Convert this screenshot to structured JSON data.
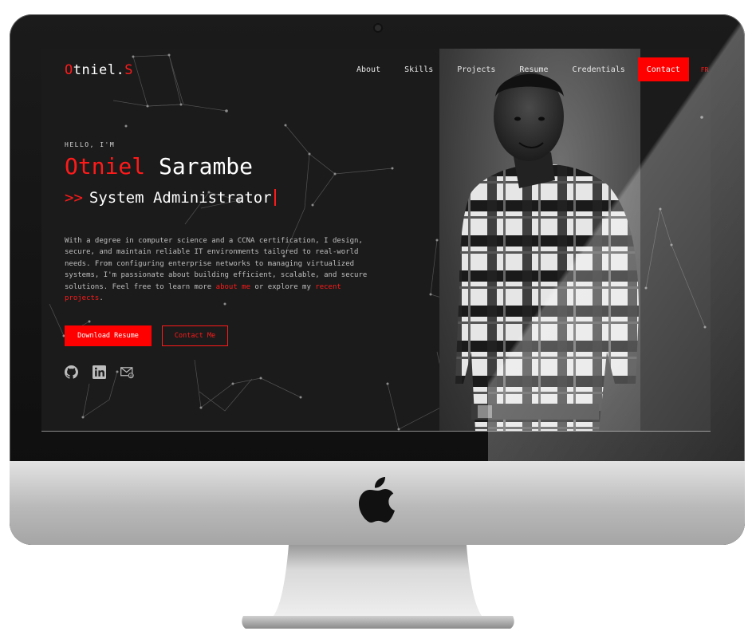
{
  "brand": {
    "name_main": "Otniel",
    "name_dot": ".",
    "name_initial": "S"
  },
  "nav": {
    "items": [
      "About",
      "Skills",
      "Projects",
      "Resume",
      "Credentials"
    ],
    "contact": "Contact",
    "lang": "FR"
  },
  "hero": {
    "greeting": "HELLO, I'M",
    "first_name": "Otniel",
    "last_name": "Sarambe",
    "role_prefix": ">>",
    "role": "System Administrator",
    "bio_part1": "With a degree in computer science and a CCNA certification, I design, secure, and maintain reliable IT environments tailored to real-world needs. From configuring enterprise networks to managing virtualized systems, I'm passionate about building efficient, scalable, and secure solutions. Feel free to learn more ",
    "bio_link1": "about me",
    "bio_part2": " or explore my ",
    "bio_link2": "recent projects",
    "bio_part3": ".",
    "download_button": "Download Resume",
    "contact_button": "Contact Me"
  },
  "social_icons": [
    "github-icon",
    "linkedin-icon",
    "email-icon"
  ],
  "colors": {
    "accent": "#ff0000",
    "background": "#1b1b1b",
    "text": "#ffffff"
  }
}
